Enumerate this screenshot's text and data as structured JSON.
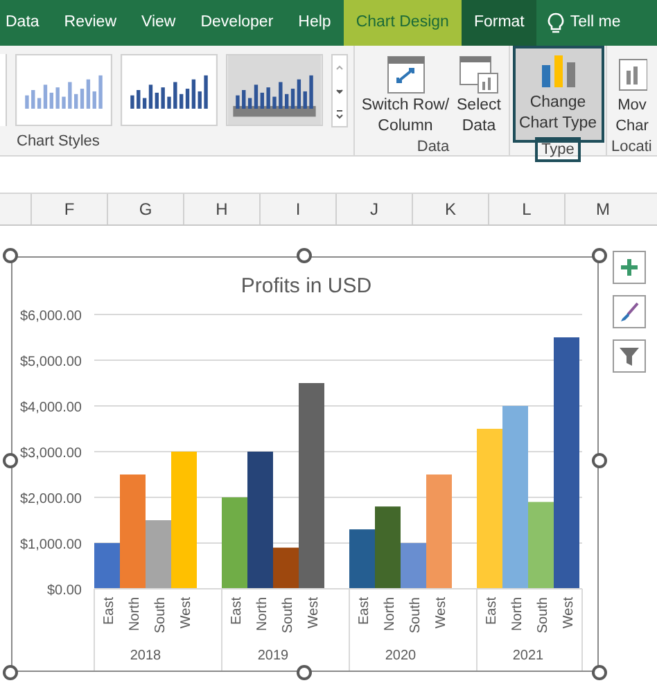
{
  "tabs": [
    {
      "label": "Data",
      "selected": false,
      "contextual": false
    },
    {
      "label": "Review",
      "selected": false,
      "contextual": false
    },
    {
      "label": "View",
      "selected": false,
      "contextual": false
    },
    {
      "label": "Developer",
      "selected": false,
      "contextual": false
    },
    {
      "label": "Help",
      "selected": false,
      "contextual": false
    },
    {
      "label": "Chart Design",
      "selected": true,
      "contextual": true
    },
    {
      "label": "Format",
      "selected": false,
      "contextual": true
    }
  ],
  "tell_me": "Tell me",
  "ribbon": {
    "groups": [
      {
        "label": "Chart Styles",
        "boxed": false
      },
      {
        "label": "Data",
        "boxed": false
      },
      {
        "label": "Type",
        "boxed": true
      },
      {
        "label": "Locati",
        "boxed": false
      }
    ],
    "buttons": [
      {
        "kind": "switch",
        "lines": [
          "Switch Row/",
          "Column"
        ],
        "selected": false
      },
      {
        "kind": "select",
        "lines": [
          "Select",
          "Data"
        ],
        "selected": false
      },
      {
        "kind": "change",
        "lines": [
          "Change",
          "Chart Type"
        ],
        "selected": true
      },
      {
        "kind": "move",
        "lines": [
          "Mov",
          "Char"
        ],
        "selected": false
      }
    ]
  },
  "columns": [
    "F",
    "G",
    "H",
    "I",
    "J",
    "K",
    "L",
    "M"
  ],
  "chart": {
    "chart_data": {
      "type": "bar",
      "title": "Profits in USD",
      "categories": [
        "East",
        "North",
        "South",
        "West",
        "East",
        "North",
        "South",
        "West",
        "East",
        "North",
        "South",
        "West",
        "East",
        "North",
        "South",
        "West"
      ],
      "grid": true,
      "series": [
        {
          "values": [
            1000,
            2500,
            1500,
            3000,
            2000,
            3000,
            900,
            4500,
            1300,
            1800,
            1000,
            2500,
            3500,
            4000,
            1900,
            5500
          ]
        }
      ],
      "ylim": [
        0,
        6000
      ],
      "yticks": [
        {
          "value": 0,
          "label": "$0.00"
        },
        {
          "value": 1000,
          "label": "$1,000.00"
        },
        {
          "value": 2000,
          "label": "$2,000.00"
        },
        {
          "value": 3000,
          "label": "$3,000.00"
        },
        {
          "value": 4000,
          "label": "$4,000.00"
        },
        {
          "value": 5000,
          "label": "$5,000.00"
        },
        {
          "value": 6000,
          "label": "$6,000.00"
        }
      ]
    },
    "groups": [
      "2018",
      "2019",
      "2020",
      "2021"
    ],
    "bar_colors": [
      {
        "color": "#4472c4"
      },
      {
        "color": "#ed7d31"
      },
      {
        "color": "#a5a5a5"
      },
      {
        "color": "#ffc000"
      },
      {
        "color": "#70ad47"
      },
      {
        "color": "#264478"
      },
      {
        "color": "#9e480e"
      },
      {
        "color": "#636363"
      },
      {
        "color": "#255e91"
      },
      {
        "color": "#43682b"
      },
      {
        "color": "#698ed0"
      },
      {
        "color": "#f1975a"
      },
      {
        "color": "#ffc935"
      },
      {
        "color": "#7cafdd"
      },
      {
        "color": "#8cc168"
      },
      {
        "color": "#335aa1"
      }
    ]
  }
}
